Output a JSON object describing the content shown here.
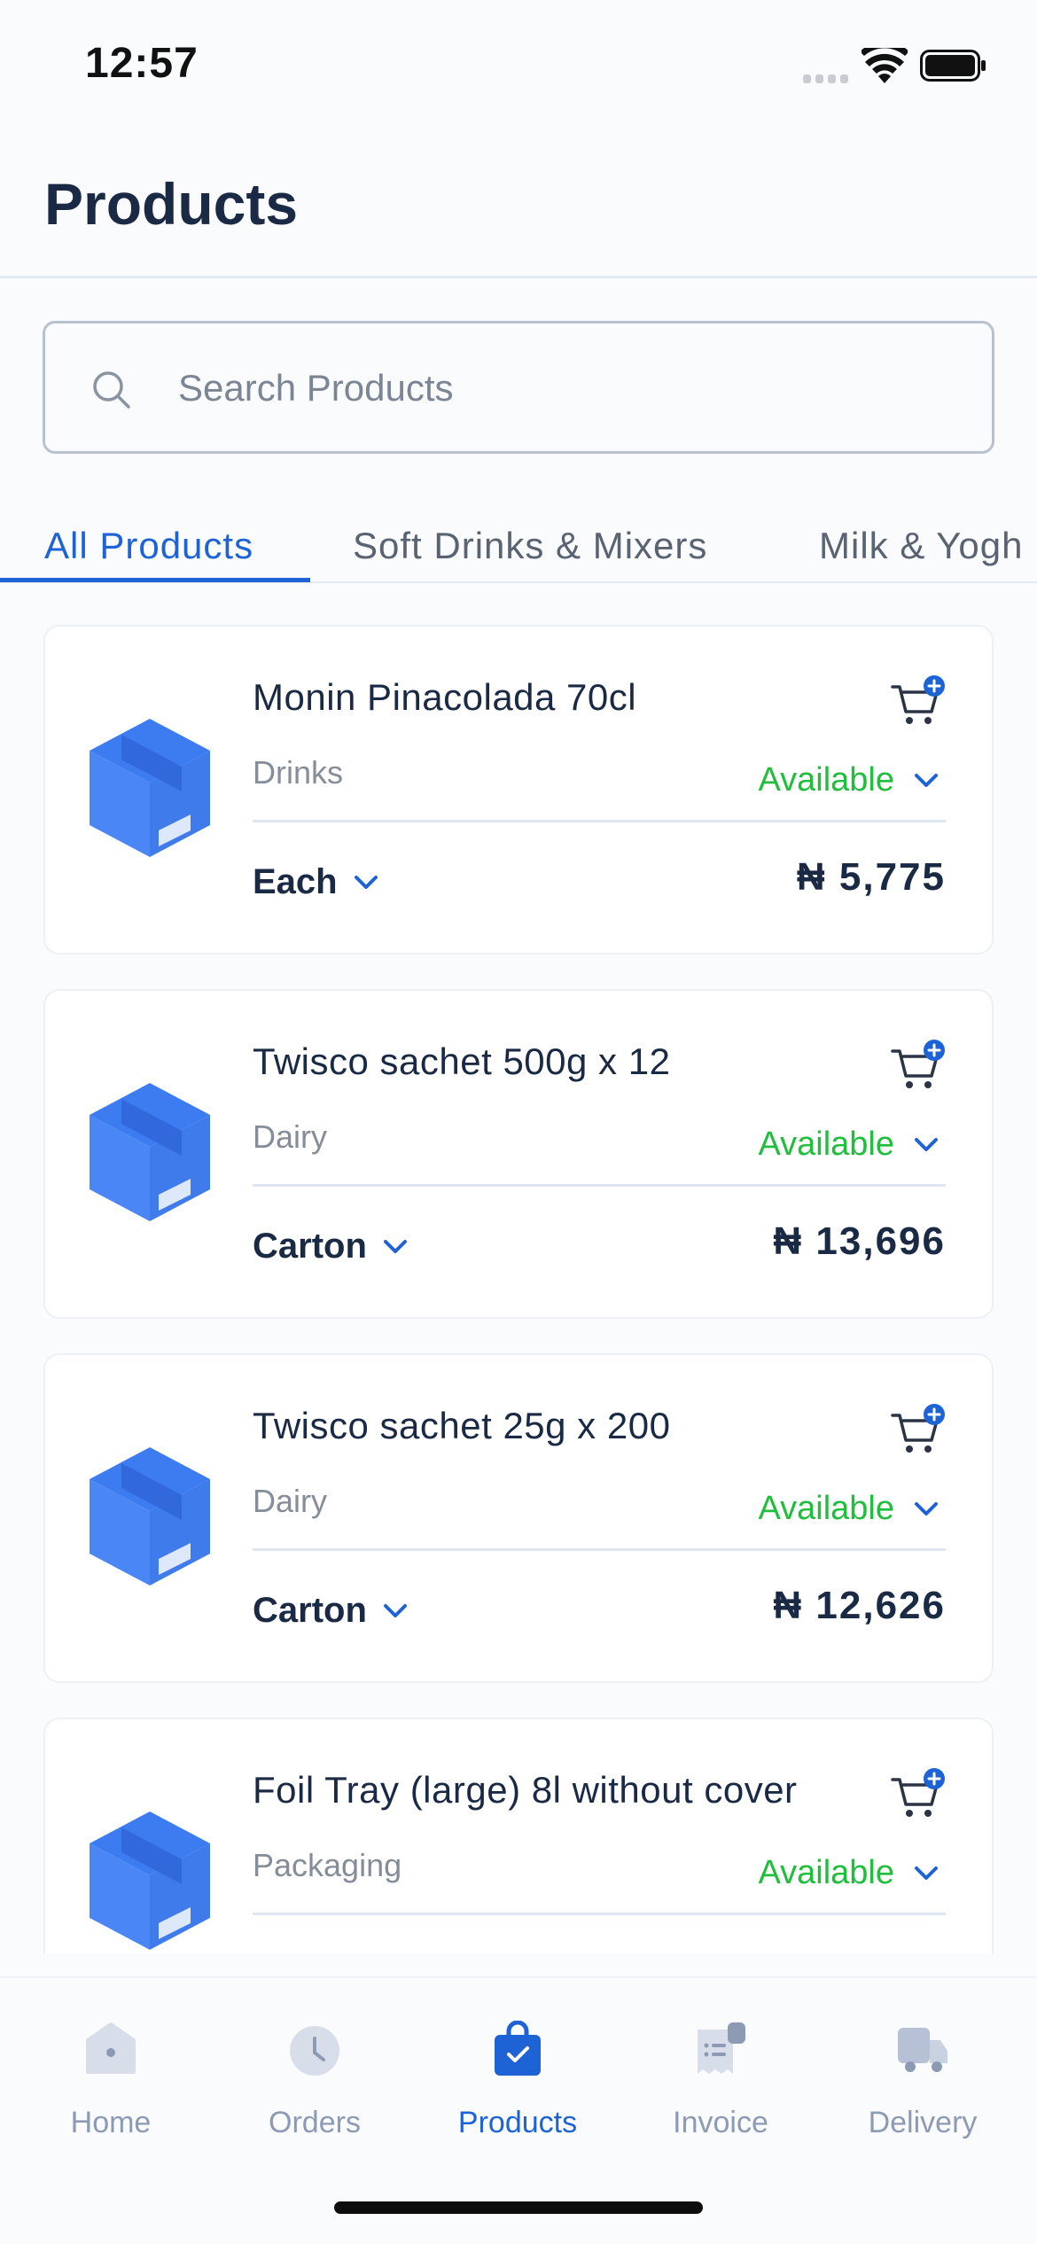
{
  "status_bar": {
    "time": "12:57"
  },
  "header": {
    "title": "Products"
  },
  "search": {
    "placeholder": "Search Products",
    "value": ""
  },
  "tabs": [
    {
      "label": "All Products",
      "active": true
    },
    {
      "label": "Soft Drinks & Mixers",
      "active": false
    },
    {
      "label": "Milk & Yogh",
      "active": false
    }
  ],
  "products": [
    {
      "name": "Monin Pinacolada 70cl",
      "category": "Drinks",
      "availability": "Available",
      "unit": "Each",
      "price": "₦ 5,775"
    },
    {
      "name": "Twisco sachet 500g x 12",
      "category": "Dairy",
      "availability": "Available",
      "unit": "Carton",
      "price": "₦ 13,696"
    },
    {
      "name": "Twisco sachet 25g x 200",
      "category": "Dairy",
      "availability": "Available",
      "unit": "Carton",
      "price": "₦ 12,626"
    },
    {
      "name": "Foil Tray (large) 8l without cover",
      "category": "Packaging",
      "availability": "Available",
      "unit": "",
      "price": ""
    }
  ],
  "bottom_nav": [
    {
      "label": "Home",
      "icon": "home-icon",
      "active": false
    },
    {
      "label": "Orders",
      "icon": "clock-icon",
      "active": false
    },
    {
      "label": "Products",
      "icon": "shopping-bag-icon",
      "active": true
    },
    {
      "label": "Invoice",
      "icon": "receipt-icon",
      "active": false
    },
    {
      "label": "Delivery",
      "icon": "truck-icon",
      "active": false
    }
  ],
  "colors": {
    "accent": "#1E63D6",
    "available": "#20BE3C",
    "text_primary": "#1B2A44",
    "text_muted": "#858D99",
    "nav_inactive": "#8D9AB4"
  }
}
